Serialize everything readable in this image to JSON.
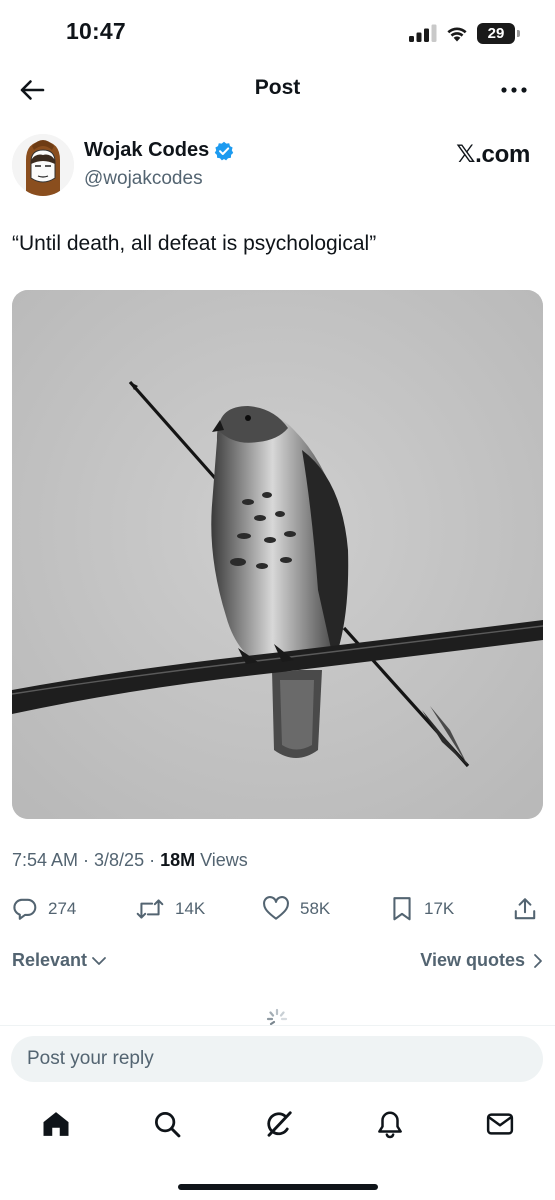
{
  "status_bar": {
    "time": "10:47",
    "battery_level": "29",
    "icons": [
      "cellular-signal-icon",
      "wifi-icon",
      "battery-icon"
    ]
  },
  "header": {
    "title": "Post",
    "back_icon": "arrow-left-icon",
    "more_icon": "more-dots-icon"
  },
  "author": {
    "name": "Wojak Codes",
    "handle": "@wojakcodes",
    "verified": true,
    "brand": "𝕏.com"
  },
  "tweet": {
    "text": "“Until death, all defeat is psychological”",
    "media_description_icon": "hawk-photo-image",
    "timestamp": "7:54 AM · 3/8/25 · ",
    "views_count": "18M",
    "views_label": " Views"
  },
  "actions": {
    "replies": "274",
    "reposts": "14K",
    "likes": "58K",
    "bookmarks": "17K"
  },
  "reply_filters": {
    "sort_label": "Relevant",
    "quotes_label": "View quotes"
  },
  "reply_box": {
    "placeholder": "Post your reply"
  },
  "tabbar": {
    "items": [
      "home-icon",
      "search-icon",
      "grok-icon",
      "notifications-icon",
      "messages-icon"
    ]
  },
  "colors": {
    "text_primary": "#0f1419",
    "text_secondary": "#536471",
    "verified": "#1d9bf0",
    "reply_background": "#eff3f4"
  }
}
